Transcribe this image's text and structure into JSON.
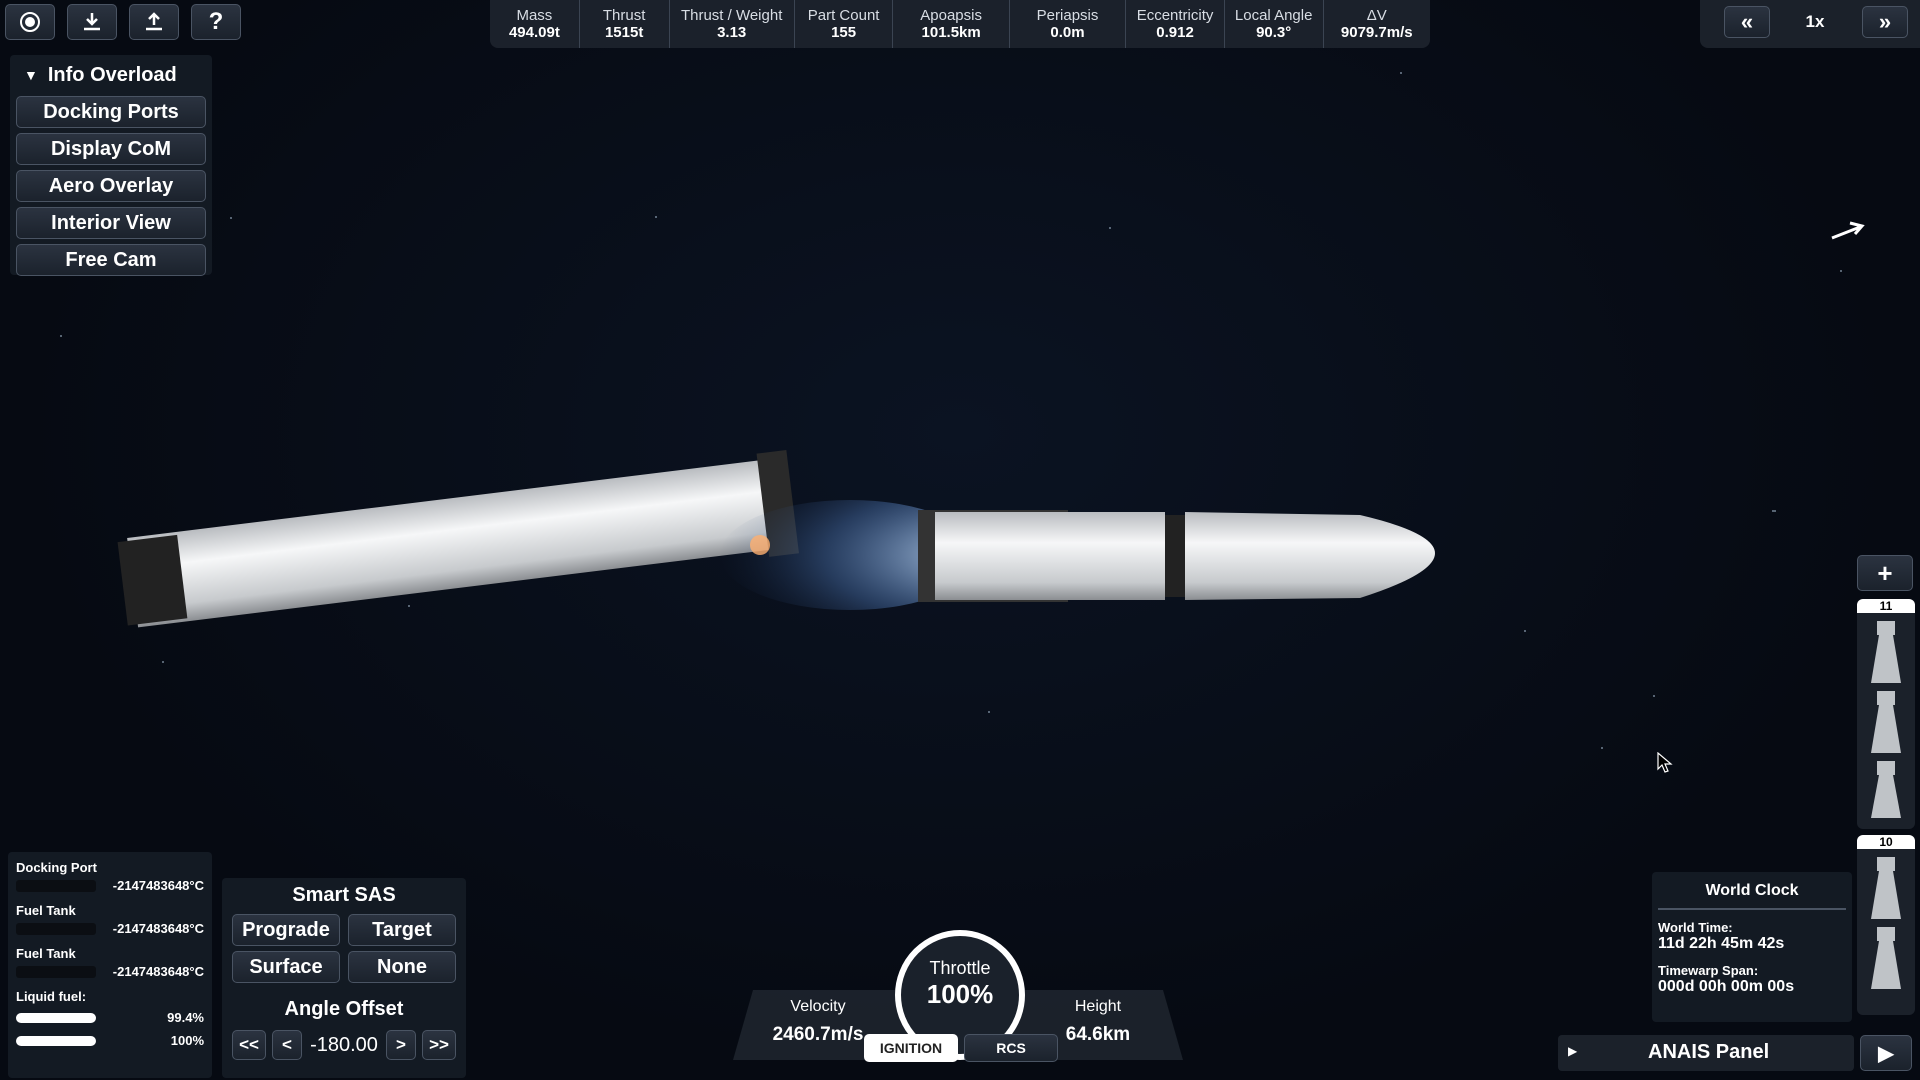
{
  "top_bar": {
    "stats": [
      {
        "label": "Mass",
        "value": "494.09t"
      },
      {
        "label": "Thrust",
        "value": "1515t"
      },
      {
        "label": "Thrust / Weight",
        "value": "3.13"
      },
      {
        "label": "Part Count",
        "value": "155"
      },
      {
        "label": "Apoapsis",
        "value": "101.5km"
      },
      {
        "label": "Periapsis",
        "value": "0.0m"
      },
      {
        "label": "Eccentricity",
        "value": "0.912"
      },
      {
        "label": "Local Angle",
        "value": "90.3°"
      },
      {
        "label": "ΔV",
        "value": "9079.7m/s"
      }
    ]
  },
  "toolbar_left": {
    "icons": [
      "orbit-icon",
      "download-icon",
      "upload-icon",
      "help-icon"
    ],
    "help_label": "?"
  },
  "timewarp": {
    "slower": "«",
    "rate": "1x",
    "faster": "»"
  },
  "menu": {
    "title": "Info Overload",
    "items": [
      "Docking Ports",
      "Display CoM",
      "Aero Overlay",
      "Interior View",
      "Free Cam"
    ]
  },
  "temperatures": {
    "rows": [
      {
        "label": "Docking Port",
        "value": "-2147483648°C"
      },
      {
        "label": "Fuel Tank",
        "value": "-2147483648°C"
      },
      {
        "label": "Fuel Tank",
        "value": "-2147483648°C"
      }
    ],
    "liquid_fuel_label": "Liquid fuel:",
    "fuel": [
      "99.4%",
      "100%"
    ]
  },
  "smart_sas": {
    "title": "Smart SAS",
    "buttons": [
      "Prograde",
      "Target",
      "Surface",
      "None"
    ],
    "angle_title": "Angle Offset",
    "angle_value": "-180.00",
    "controls": [
      "<<",
      "<",
      ">",
      ">>"
    ]
  },
  "flight": {
    "velocity_label": "Velocity",
    "velocity": "2460.7m/s",
    "throttle_label": "Throttle",
    "throttle": "100%",
    "height_label": "Height",
    "height": "64.6km",
    "ignition": "IGNITION",
    "rcs": "RCS"
  },
  "world_clock": {
    "title": "World Clock",
    "time_label": "World Time:",
    "time": "11d 22h 45m 42s",
    "span_label": "Timewarp Span:",
    "span": "000d 00h 00m 00s"
  },
  "anais": {
    "label": "ANAIS Panel"
  },
  "stages": {
    "add": "+",
    "numbers": [
      "11",
      "10"
    ]
  }
}
